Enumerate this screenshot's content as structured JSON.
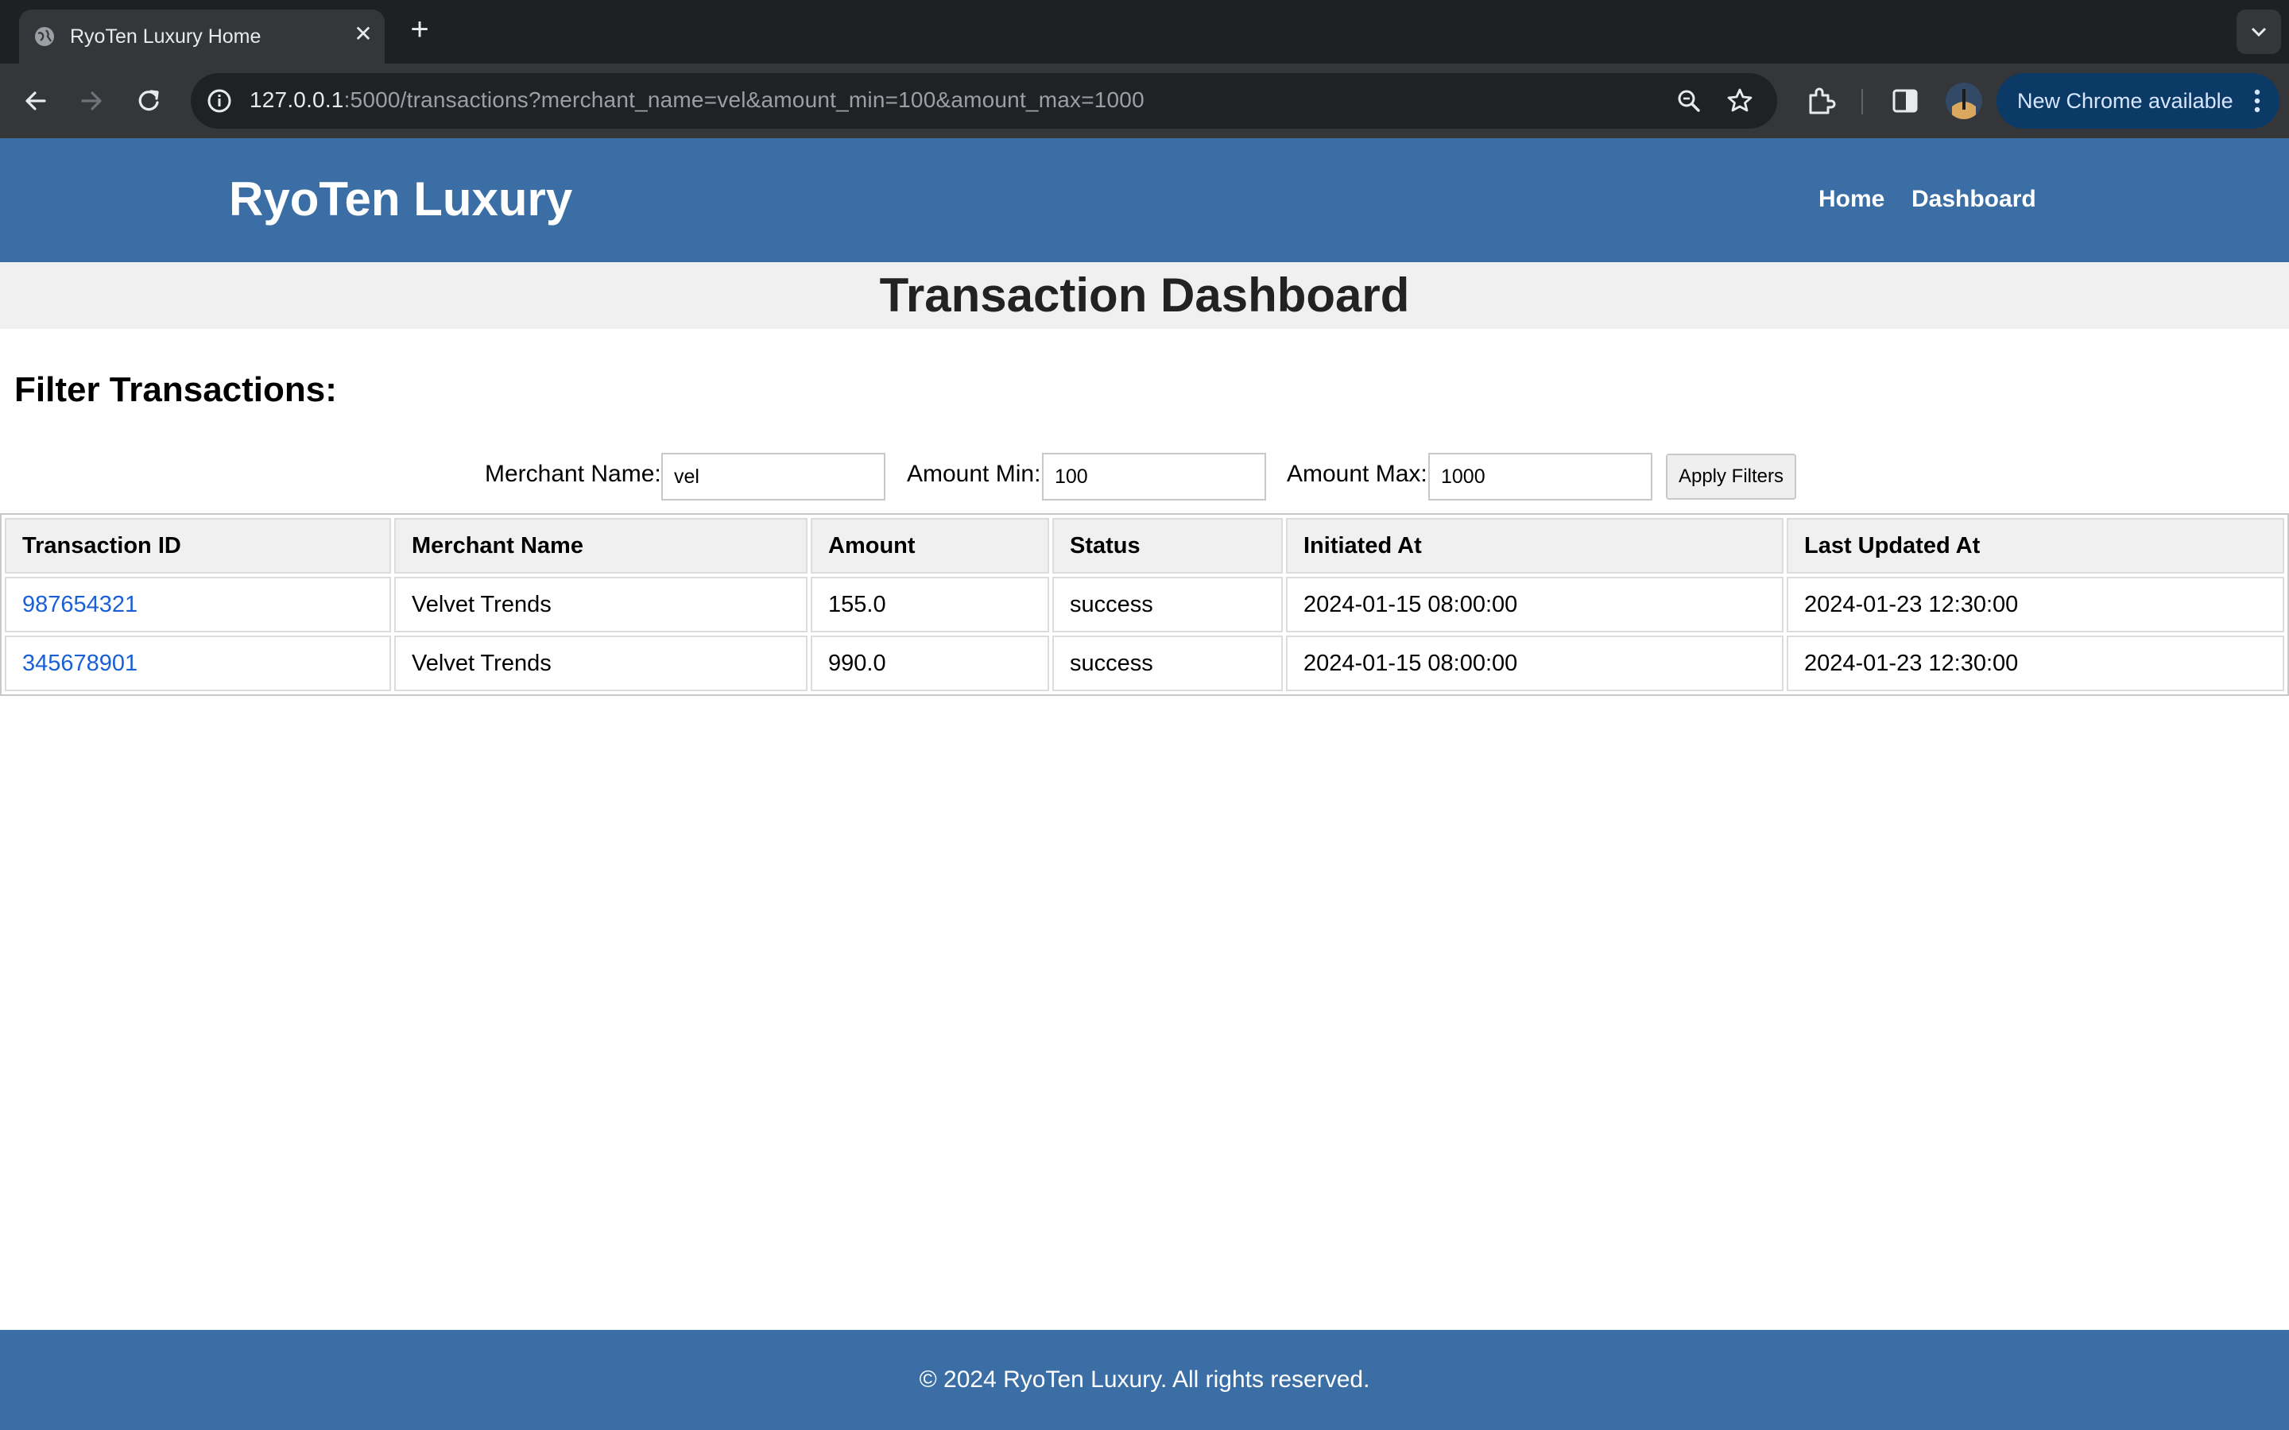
{
  "browser": {
    "tab_title": "RyoTen Luxury Home",
    "new_tab_symbol": "+",
    "close_symbol": "✕",
    "url_host": "127.0.0.1",
    "url_rest": ":5000/transactions?merchant_name=vel&amount_min=100&amount_max=1000",
    "update_label": "New Chrome available",
    "icons": [
      "globe-icon",
      "back-icon",
      "forward-icon",
      "reload-icon",
      "site-info-icon",
      "zoom-icon",
      "bookmark-star-icon",
      "extensions-icon",
      "side-panel-icon",
      "profile-avatar",
      "more-vert-icon",
      "tab-search-icon"
    ]
  },
  "header": {
    "brand": "RyoTen Luxury",
    "nav": [
      {
        "label": "Home"
      },
      {
        "label": "Dashboard"
      }
    ],
    "bg_color": "#3a6ea5"
  },
  "page": {
    "title": "Transaction Dashboard"
  },
  "filters": {
    "heading": "Filter Transactions:",
    "merchant_label": "Merchant Name:",
    "merchant_value": "vel",
    "amount_min_label": "Amount Min:",
    "amount_min_value": "100",
    "amount_max_label": "Amount Max:",
    "amount_max_value": "1000",
    "apply_label": "Apply Filters"
  },
  "table": {
    "headers": [
      "Transaction ID",
      "Merchant Name",
      "Amount",
      "Status",
      "Initiated At",
      "Last Updated At"
    ],
    "rows": [
      {
        "id": "987654321",
        "merchant": "Velvet Trends",
        "amount": "155.0",
        "status": "success",
        "initiated": "2024-01-15 08:00:00",
        "updated": "2024-01-23 12:30:00"
      },
      {
        "id": "345678901",
        "merchant": "Velvet Trends",
        "amount": "990.0",
        "status": "success",
        "initiated": "2024-01-15 08:00:00",
        "updated": "2024-01-23 12:30:00"
      }
    ],
    "link_color": "#1a5fd6"
  },
  "footer": {
    "text": "© 2024 RyoTen Luxury. All rights reserved."
  }
}
